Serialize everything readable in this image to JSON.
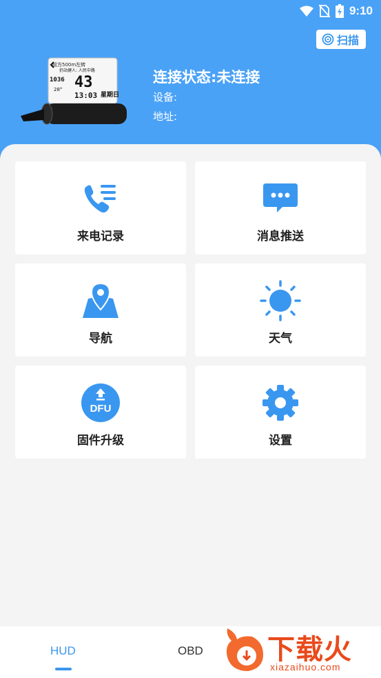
{
  "status_bar": {
    "time": "9:10"
  },
  "header": {
    "scan_label": "扫描",
    "connection_status": "连接状态:未连接",
    "device_label": "设备:",
    "address_label": "地址:"
  },
  "device_display": {
    "line1": "前方500m左转",
    "line2": "扔站健人: 人民中路",
    "speed": "43",
    "clock": "13:03",
    "time_small": "1036",
    "temp": "28°",
    "day": "星期日"
  },
  "menu": [
    {
      "label": "来电记录",
      "icon": "phone-list-icon"
    },
    {
      "label": "消息推送",
      "icon": "message-icon"
    },
    {
      "label": "导航",
      "icon": "map-pin-icon"
    },
    {
      "label": "天气",
      "icon": "sun-icon"
    },
    {
      "label": "固件升级",
      "icon": "dfu-upgrade-icon",
      "badge": "DFU"
    },
    {
      "label": "设置",
      "icon": "gear-icon"
    }
  ],
  "tabs": [
    {
      "label": "HUD",
      "active": true
    },
    {
      "label": "OBD",
      "active": false
    }
  ],
  "watermark": {
    "text": "下载火",
    "url": "xiazaihuo.com"
  },
  "colors": {
    "primary": "#4aa2f7",
    "accent": "#3b95ef",
    "watermark": "#e94a1c"
  }
}
